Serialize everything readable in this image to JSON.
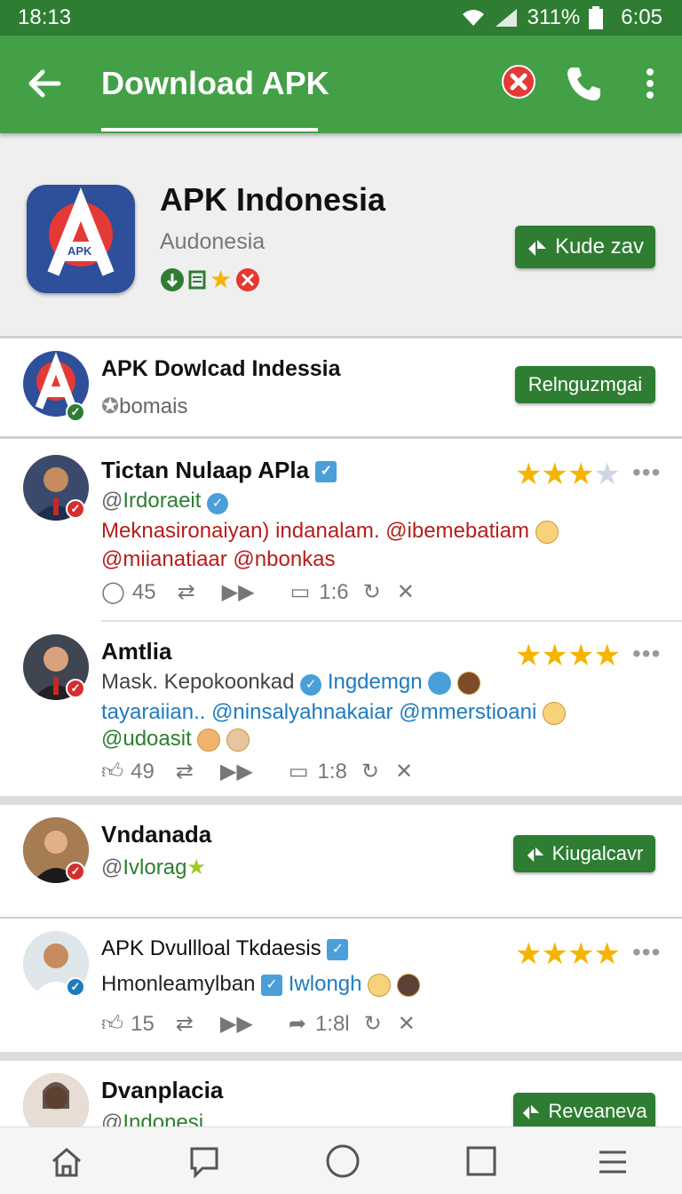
{
  "status_bar": {
    "time_left": "18:13",
    "battery": "311%",
    "time_right": "6:05"
  },
  "app_bar": {
    "title": "Download APK"
  },
  "app_header": {
    "name": "APK Indonesia",
    "developer": "Audonesia",
    "logo_text": "APK",
    "button_label": "Kude zav"
  },
  "featured": {
    "name": "APK Dowlcad Indessia",
    "sub": "bomais",
    "button_label": "Relnguzmgai"
  },
  "posts": [
    {
      "name": "Tictan Nulaap APla",
      "handle": "Irdoraeit",
      "line1": "Meknasironaiyan) indanalam. @ibemebatiam",
      "line2": "@miianatiaar @nbonkas",
      "likes": "45",
      "replies": "1:6",
      "rating": 3
    },
    {
      "name": "Amtlia",
      "line1_a": "Mask. Kepokoonkad",
      "line1_b": "Ingdemgn",
      "line2": "tayaraiian.. @ninsalyahnakaiar @mmerstioani",
      "line3": "@udoasit",
      "likes": "49",
      "replies": "1:8",
      "rating": 4
    }
  ],
  "vndanada": {
    "name": "Vndanada",
    "handle": "Ivlorag",
    "button_label": "Kiugalcavr"
  },
  "post3": {
    "name": "APK Dvullloal Tkdaesis",
    "line1_a": "Hmonleamylban",
    "line1_b": "Iwlongh",
    "likes": "15",
    "replies": "1:8l",
    "rating": 4
  },
  "last": {
    "name": "Dvanplacia",
    "handle": "Indonesi",
    "button_label": "Reveaneva"
  },
  "colors": {
    "primary": "#43a047",
    "primary_dark": "#2e7d32",
    "star": "#f5b400"
  }
}
